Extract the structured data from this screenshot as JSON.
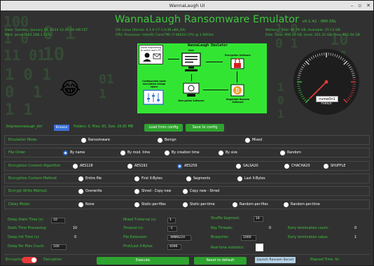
{
  "window": {
    "title": "WannaLaugh UI",
    "minimize": "–",
    "maximize": "▫",
    "close": "✕"
  },
  "header": {
    "title": "WannaLaugh Ransomware Emulator",
    "version": "v0.1.42 - IBM ZRL"
  },
  "info": {
    "date": "Date: Tuesday, January 16, 2024 12:30:18 AM CET",
    "host": "Host: jarvis (192.168.1.116)",
    "os": "OS: Linux (Kernel: 6.1.0-17-1.fc39.x86_64)",
    "cpu": "CPU: Processor: Intel(R) Core(TM) i7-8665U CPU @ 1.90GHz",
    "memory": "Memory: Total: 46.76 GB, Available: 25.14 GB",
    "disk": "Disk: Total: 908.30 GB, Used: 303.35 GB, Free: 651.94 GB"
  },
  "diagram": {
    "title": "WannaLaugh Emulator",
    "social": "Social engineering to select user's PC",
    "user": "User",
    "encsoftware": "Encryption Software",
    "config": "Configurable aside encryption design space",
    "decsoftware": "Decryption Software",
    "negotiate": "Negotiate Ransom Software"
  },
  "gauge": {
    "input_value": "nvme0n1",
    "value_label": "0 files",
    "unit": "Files/s",
    "value": 0
  },
  "path": {
    "value": "/tmp/wannalaugh_dir/",
    "browse": "Browse",
    "stats": "Folders: 0, Files: 60, Size: 26.85 MB",
    "load_config": "Load from config",
    "save_config": "Save to config"
  },
  "rows": [
    {
      "label": "Emulation Mode",
      "options": [
        "Ransomware",
        "Benign",
        "Mixed"
      ],
      "selected": 0
    },
    {
      "label": "File Order",
      "options": [
        "By name",
        "By mod. time",
        "By creation time",
        "By size",
        "Random"
      ],
      "selected": 0
    },
    {
      "label": "Encryption Content Algorithm",
      "options": [
        "AES128",
        "AES192",
        "AES256",
        "SALSA20",
        "CHACHA20",
        "SHUFFLE"
      ],
      "selected": 2
    },
    {
      "label": "Encryption Content Method",
      "options": [
        "Entire file",
        "First X-Bytes",
        "Segments",
        "Last X-Bytes"
      ],
      "selected": 0
    },
    {
      "label": "Encrypt Write Method:",
      "options": [
        "Overwrite",
        "Shred - Copy new",
        "Copy new - Shred"
      ],
      "selected": 0
    },
    {
      "label": "Delay Mode:",
      "options": [
        "None",
        "Static-per-files",
        "Static-per-time",
        "Random-per-files",
        "Random-per-time"
      ],
      "selected": 0
    }
  ],
  "params": {
    "delay_static": {
      "label": "Delay Static Time (s):",
      "value": "10"
    },
    "static_proc": {
      "label": "Static Time Processing:",
      "value": "10"
    },
    "delay_init": {
      "label": "Delay Init Time (s):",
      "value": "0"
    },
    "delay_files": {
      "label": "Delay Per Files Count:",
      "value": "100"
    },
    "mixed": {
      "label": "Mixed T-interval (s):",
      "value": "1"
    },
    "timeout": {
      "label": "Timeout (s):",
      "value": "-1"
    },
    "file_ext": {
      "label": "File Extension:",
      "value": ".WNNLGH"
    },
    "first_last": {
      "label": "First/Last X-Bytes:",
      "value": "4096"
    },
    "shuffle": {
      "label": "Shuffle Segment:",
      "value": "16"
    },
    "ray": {
      "label": "Ray Threads:",
      "value": "0"
    },
    "blueprints": {
      "label": "Blueprints:",
      "value": "1000"
    },
    "realtime": {
      "label": "Real-time statistics:"
    },
    "early_count": {
      "label": "Early termination count:",
      "value": "0"
    },
    "early_value": {
      "label": "Early termination value:",
      "value": "1"
    }
  },
  "footer": {
    "encryption": "Encryption",
    "decryption": "Decryption",
    "execute": "Execute",
    "reset": "Reset to default",
    "launch": "Launch Ransom Server",
    "elapsed": "Elapsed Time: 0s"
  },
  "colors": {
    "accent": "#3ec63e",
    "panel": "#313131",
    "blue": "#2b69d6",
    "toggle": "#e83a3a"
  }
}
